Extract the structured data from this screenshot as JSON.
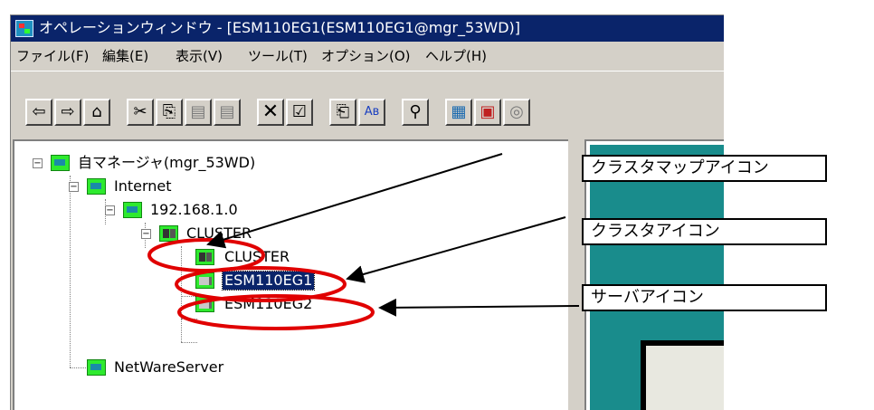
{
  "window": {
    "title": "オペレーションウィンドウ - [ESM110EG1(ESM110EG1@mgr_53WD)]"
  },
  "menubar": {
    "items": [
      "ファイル(F)",
      "編集(E)",
      "表示(V)",
      "ツール(T)",
      "オプション(O)",
      "ヘルプ(H)"
    ]
  },
  "toolbar": {
    "buttons": [
      {
        "name": "back-button",
        "glyph": "⇦",
        "icon": "back-arrow-icon"
      },
      {
        "name": "forward-button",
        "glyph": "⇨",
        "icon": "forward-arrow-icon"
      },
      {
        "name": "up-folder-button",
        "glyph": "⌂",
        "icon": "up-folder-icon"
      },
      {
        "name": "cut-button",
        "glyph": "✂",
        "icon": "scissors-icon"
      },
      {
        "name": "copy-button",
        "glyph": "⎘",
        "icon": "copy-icon"
      },
      {
        "name": "paste-button",
        "glyph": "▤",
        "icon": "paste-icon"
      },
      {
        "name": "paste-special-button",
        "glyph": "▤",
        "icon": "paste-special-icon"
      },
      {
        "name": "delete-button",
        "glyph": "✕",
        "icon": "delete-x-icon"
      },
      {
        "name": "properties-button",
        "glyph": "☑",
        "icon": "properties-icon"
      },
      {
        "name": "rename-button",
        "glyph": "⎗",
        "icon": "rename-icon"
      },
      {
        "name": "replace-button",
        "glyph": "Aʙ",
        "icon": "replace-text-icon"
      },
      {
        "name": "find-button",
        "glyph": "⚲",
        "icon": "binoculars-icon"
      },
      {
        "name": "map-view-button",
        "glyph": "▦",
        "icon": "map-view-icon"
      },
      {
        "name": "cluster-view-button",
        "glyph": "▣",
        "icon": "cluster-view-icon"
      },
      {
        "name": "server-view-button",
        "glyph": "◎",
        "icon": "server-view-icon"
      }
    ]
  },
  "tree": {
    "nodes": [
      {
        "label": "自マネージャ(mgr_53WD)",
        "icon": "map-icon",
        "expander": "minus"
      },
      {
        "label": "Internet",
        "icon": "map-icon",
        "expander": "minus"
      },
      {
        "label": "192.168.1.0",
        "icon": "map-icon",
        "expander": "minus"
      },
      {
        "label": "CLUSTER",
        "icon": "cluster-map-icon",
        "expander": "minus"
      },
      {
        "label": "CLUSTER",
        "icon": "cluster-icon",
        "expander": ""
      },
      {
        "label": "ESM110EG1",
        "icon": "server-icon",
        "expander": "",
        "selected": true
      },
      {
        "label": "ESM110EG2",
        "icon": "server-icon",
        "expander": ""
      },
      {
        "label": "NetWareServer",
        "icon": "map-icon",
        "expander": ""
      }
    ]
  },
  "callouts": {
    "cluster_map_icon": "クラスタマップアイコン",
    "cluster_icon": "クラスタアイコン",
    "server_icon": "サーバアイコン"
  },
  "colors": {
    "titlebar": "#0a246a",
    "highlight_ring": "#e00000",
    "selection": "#0a246a",
    "icon_green": "#2eea2e"
  }
}
